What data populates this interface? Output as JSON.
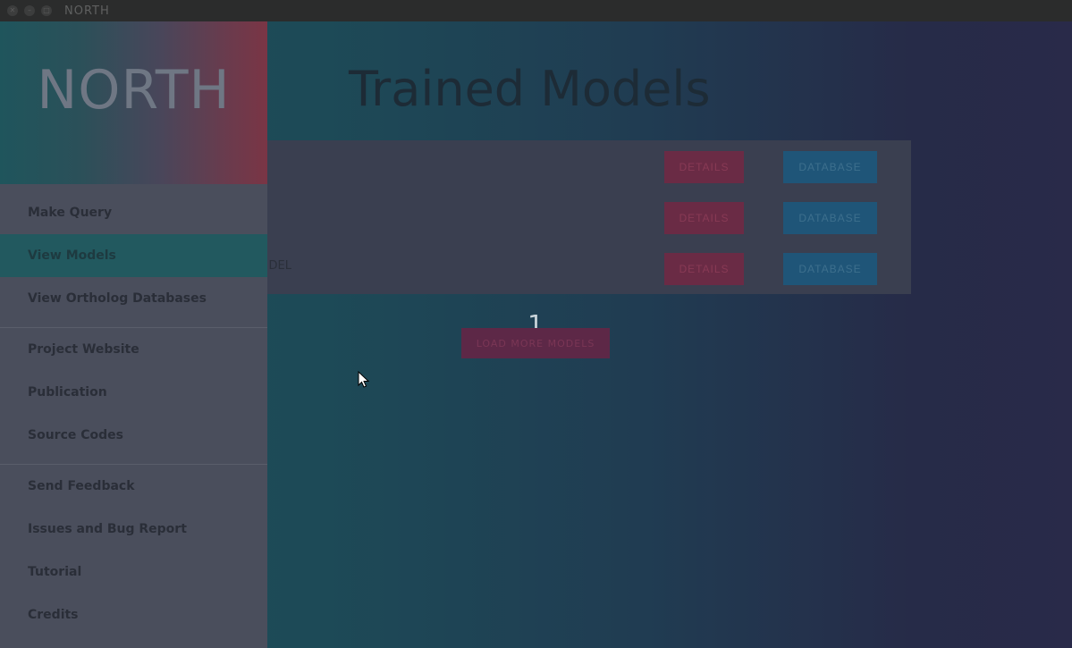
{
  "window": {
    "title": "NORTH",
    "buttons": [
      "close",
      "minimize",
      "maximize"
    ]
  },
  "drawer": {
    "brand": "NORTH",
    "groups": [
      [
        {
          "label": "Make Query",
          "active": false
        },
        {
          "label": "View Models",
          "active": true
        },
        {
          "label": "View Ortholog Databases",
          "active": false
        }
      ],
      [
        {
          "label": "Project Website",
          "active": false
        },
        {
          "label": "Publication",
          "active": false
        },
        {
          "label": "Source Codes",
          "active": false
        }
      ],
      [
        {
          "label": "Send Feedback",
          "active": false
        },
        {
          "label": "Issues and Bug Report",
          "active": false
        },
        {
          "label": "Tutorial",
          "active": false
        },
        {
          "label": "Credits",
          "active": false
        }
      ]
    ]
  },
  "main": {
    "title": "Trained Models",
    "models": [
      {
        "name": "",
        "details_label": "DETAILS",
        "database_label": "DATABASE"
      },
      {
        "name": "",
        "details_label": "DETAILS",
        "database_label": "DATABASE"
      },
      {
        "name": "DEL",
        "details_label": "DETAILS",
        "database_label": "DATABASE"
      }
    ],
    "page_number": "1",
    "load_more_label": "LOAD MORE MODELS"
  },
  "colors": {
    "drawer_bg": "#4a4e5c",
    "active_item": "#22595f",
    "details_button": "#6a2b45",
    "database_button": "#1f5578"
  }
}
